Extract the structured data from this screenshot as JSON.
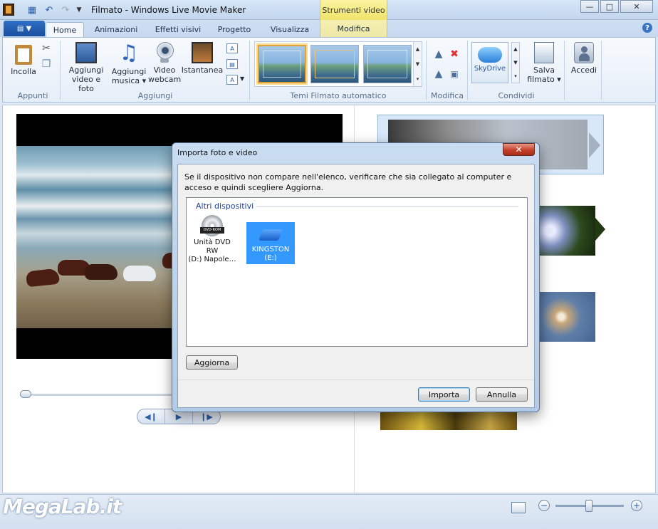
{
  "window": {
    "title": "Filmato - Windows Live Movie Maker",
    "context_tab_group": "Strumenti video"
  },
  "tabs": [
    {
      "label": "Home",
      "active": true
    },
    {
      "label": "Animazioni"
    },
    {
      "label": "Effetti visivi"
    },
    {
      "label": "Progetto"
    },
    {
      "label": "Visualizza"
    },
    {
      "label": "Modifica",
      "contextual": true
    }
  ],
  "ribbon": {
    "groups": {
      "appunti": "Appunti",
      "aggiungi": "Aggiungi",
      "temi": "Temi Filmato automatico",
      "modifica": "Modifica",
      "condividi": "Condividi"
    },
    "buttons": {
      "incolla": "Incolla",
      "aggiungi_video_1": "Aggiungi",
      "aggiungi_video_2": "video e foto",
      "aggiungi_musica_1": "Aggiungi",
      "aggiungi_musica_2": "musica",
      "video_webcam_1": "Video",
      "video_webcam_2": "webcam",
      "istantanea": "Istantanea",
      "skydrive": "SkyDrive",
      "salva_filmato_1": "Salva",
      "salva_filmato_2": "filmato",
      "accedi": "Accedi"
    }
  },
  "dialog": {
    "title": "Importa foto e video",
    "message": "Se il dispositivo non compare nell'elenco, verificare che sia collegato al computer e acceso e quindi scegliere Aggiorna.",
    "group": "Altri dispositivi",
    "devices": [
      {
        "label_1": "Unità DVD RW",
        "label_2": "(D:) Napole…",
        "icon_text": "DVD-ROM",
        "selected": false
      },
      {
        "label_1": "KINGSTON",
        "label_2": "(E:)",
        "selected": true
      }
    ],
    "refresh_button": "Aggiorna",
    "import_button": "Importa",
    "cancel_button": "Annulla"
  },
  "watermark": "MegaLab.it",
  "colors": {
    "selection": "#3399ff",
    "ribbon_bg": "#f7fafd",
    "contextual_tab": "#f0e36a"
  }
}
